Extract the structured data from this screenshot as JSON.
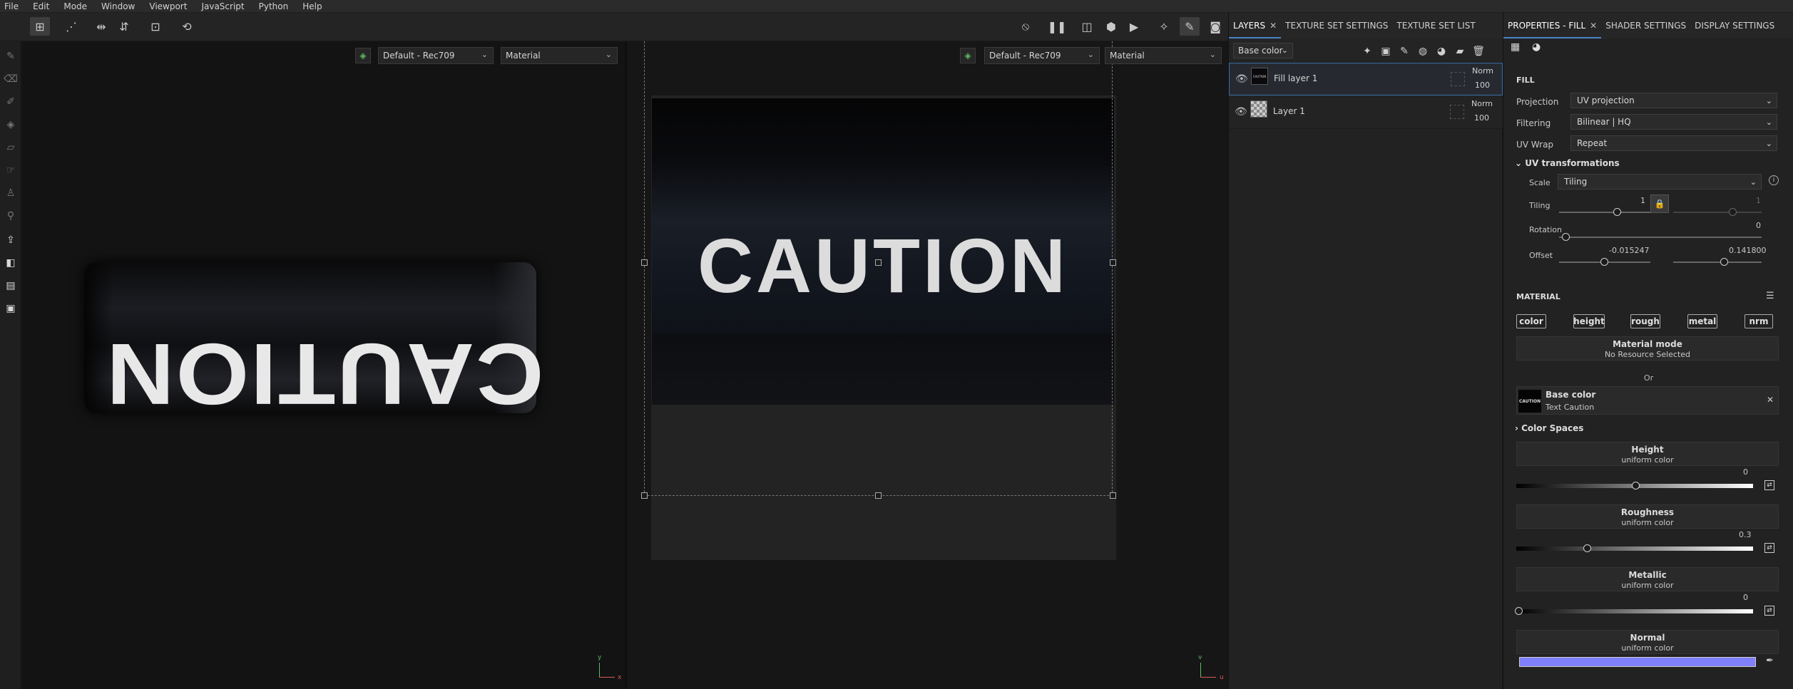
{
  "menu": [
    "File",
    "Edit",
    "Mode",
    "Window",
    "Viewport",
    "JavaScript",
    "Python",
    "Help"
  ],
  "viewport3d": {
    "colorspace": "Default - Rec709",
    "channel": "Material",
    "caption": "CAUTION",
    "axis_x": "x",
    "axis_y": "y"
  },
  "viewport2d": {
    "colorspace": "Default - Rec709",
    "channel": "Material",
    "caption": "CAUTION",
    "axis_u": "u",
    "axis_v": "v"
  },
  "layers_panel": {
    "tabs": [
      {
        "label": "LAYERS",
        "close": "✕"
      },
      {
        "label": "TEXTURE SET SETTINGS"
      },
      {
        "label": "TEXTURE SET LIST"
      }
    ],
    "channel_select": "Base color",
    "layers": [
      {
        "name": "Fill layer 1",
        "blend": "Norm",
        "opacity": "100",
        "thumb_text": "CAUTION"
      },
      {
        "name": "Layer 1",
        "blend": "Norm",
        "opacity": "100"
      }
    ]
  },
  "properties": {
    "tabs": [
      {
        "label": "PROPERTIES - FILL",
        "close": "✕"
      },
      {
        "label": "SHADER SETTINGS"
      },
      {
        "label": "DISPLAY SETTINGS"
      }
    ],
    "fill_title": "FILL",
    "projection_label": "Projection",
    "projection": "UV projection",
    "filtering_label": "Filtering",
    "filtering": "Bilinear | HQ",
    "uvwrap_label": "UV Wrap",
    "uvwrap": "Repeat",
    "uvtrans_title": "UV transformations",
    "scale_label": "Scale",
    "scale": "Tiling",
    "tiling_label": "Tiling",
    "tiling_value": "1",
    "tiling_value2": "1",
    "rotation_label": "Rotation",
    "rotation_value": "0",
    "offset_label": "Offset",
    "offset_u": "-0.015247",
    "offset_v": "0.141800",
    "material_title": "MATERIAL",
    "chips": [
      "color",
      "height",
      "rough",
      "metal",
      "nrm"
    ],
    "material_mode_title": "Material mode",
    "material_mode_sub": "No Resource Selected",
    "or_text": "Or",
    "base_color_title": "Base color",
    "base_color_sub": "Text Caution",
    "base_color_thumb": "CAUTION",
    "color_spaces": "Color Spaces",
    "height_title": "Height",
    "height_sub": "uniform color",
    "height_value": "0",
    "rough_title": "Roughness",
    "rough_sub": "uniform color",
    "rough_value": "0.3",
    "metal_title": "Metallic",
    "metal_sub": "uniform color",
    "metal_value": "0",
    "normal_title": "Normal",
    "normal_sub": "uniform color",
    "normal_color": "#8080ff"
  }
}
